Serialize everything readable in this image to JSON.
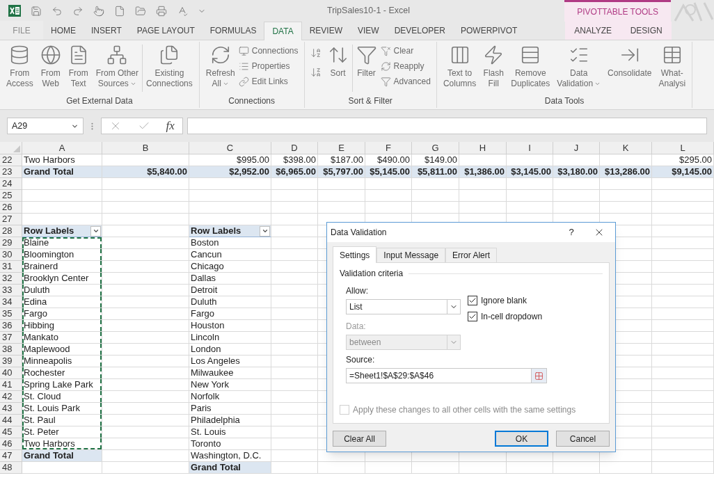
{
  "title_bar": {
    "title": "TripSales10-1 - Excel",
    "context_header": "PIVOTTABLE TOOLS"
  },
  "ribbon_tabs": [
    {
      "label": "FILE",
      "kind": "file",
      "selected": false
    },
    {
      "label": "HOME",
      "kind": "normal",
      "selected": false
    },
    {
      "label": "INSERT",
      "kind": "normal",
      "selected": false
    },
    {
      "label": "PAGE LAYOUT",
      "kind": "normal",
      "selected": false
    },
    {
      "label": "FORMULAS",
      "kind": "normal",
      "selected": false
    },
    {
      "label": "DATA",
      "kind": "normal",
      "selected": true
    },
    {
      "label": "REVIEW",
      "kind": "normal",
      "selected": false
    },
    {
      "label": "VIEW",
      "kind": "normal",
      "selected": false
    },
    {
      "label": "DEVELOPER",
      "kind": "normal",
      "selected": false
    },
    {
      "label": "POWERPIVOT",
      "kind": "normal",
      "selected": false
    },
    {
      "label": "ANALYZE",
      "kind": "contextual",
      "selected": false
    },
    {
      "label": "DESIGN",
      "kind": "contextual",
      "selected": false
    }
  ],
  "ribbon": {
    "groups": [
      {
        "label": "Get External Data",
        "items": [
          {
            "kind": "large",
            "lines": [
              "From",
              "Access"
            ],
            "dropdown": false
          },
          {
            "kind": "large",
            "lines": [
              "From",
              "Web"
            ],
            "dropdown": false
          },
          {
            "kind": "large",
            "lines": [
              "From",
              "Text"
            ],
            "dropdown": false
          },
          {
            "kind": "large",
            "lines": [
              "From Other",
              "Sources"
            ],
            "dropdown": true
          },
          {
            "kind": "separator"
          },
          {
            "kind": "large",
            "lines": [
              "Existing",
              "Connections"
            ],
            "dropdown": false
          }
        ]
      },
      {
        "label": "Connections",
        "items": [
          {
            "kind": "large",
            "lines": [
              "Refresh",
              "All"
            ],
            "dropdown": true
          },
          {
            "kind": "stack",
            "entries": [
              "Connections",
              "Properties",
              "Edit Links"
            ]
          }
        ]
      },
      {
        "label": "Sort & Filter",
        "items": [
          {
            "kind": "sort_buttons"
          },
          {
            "kind": "large",
            "lines": [
              "Sort"
            ],
            "dropdown": false
          },
          {
            "kind": "separator"
          },
          {
            "kind": "large",
            "lines": [
              "Filter"
            ],
            "dropdown": false
          },
          {
            "kind": "stack",
            "entries": [
              "Clear",
              "Reapply",
              "Advanced"
            ]
          }
        ]
      },
      {
        "label": "Data Tools",
        "items": [
          {
            "kind": "large",
            "lines": [
              "Text to",
              "Columns"
            ],
            "dropdown": false
          },
          {
            "kind": "large",
            "lines": [
              "Flash",
              "Fill"
            ],
            "dropdown": false
          },
          {
            "kind": "large",
            "lines": [
              "Remove",
              "Duplicates"
            ],
            "dropdown": false
          },
          {
            "kind": "large",
            "lines": [
              "Data",
              "Validation"
            ],
            "dropdown": true
          },
          {
            "kind": "large",
            "lines": [
              "Consolidate"
            ],
            "dropdown": false
          },
          {
            "kind": "large",
            "lines": [
              "What-",
              "Analysi"
            ],
            "dropdown": false
          }
        ]
      }
    ]
  },
  "formula_bar": {
    "name_box": "A29",
    "function_label": "fx"
  },
  "sheet": {
    "columns": [
      "A",
      "B",
      "C",
      "D",
      "E",
      "F",
      "G",
      "H",
      "I",
      "J",
      "K",
      "L"
    ],
    "row_numbers": [
      "22",
      "23",
      "24",
      "25",
      "26",
      "27",
      "28",
      "29",
      "30",
      "31",
      "32",
      "33",
      "34",
      "35",
      "36",
      "37",
      "38",
      "39",
      "40",
      "41",
      "42",
      "43",
      "44",
      "45",
      "46",
      "47",
      "48"
    ],
    "rows": [
      {
        "kind": "values",
        "cells": [
          "Two Harbors",
          "",
          "$995.00",
          "$398.00",
          "$187.00",
          "$490.00",
          "$149.00",
          "",
          "",
          "",
          "",
          "$295.00"
        ]
      },
      {
        "kind": "grand_total",
        "cells": [
          "Grand Total",
          "$5,840.00",
          "$2,952.00",
          "$6,965.00",
          "$5,797.00",
          "$5,145.00",
          "$5,811.00",
          "$1,386.00",
          "$3,145.00",
          "$3,180.00",
          "$13,286.00",
          "$9,145.00"
        ]
      }
    ],
    "pivots": [
      {
        "header": "Row Labels",
        "copy_marquee": true,
        "items": [
          "Blaine",
          "Bloomington",
          "Brainerd",
          "Brooklyn Center",
          "Duluth",
          "Edina",
          "Fargo",
          "Hibbing",
          "Mankato",
          "Maplewood",
          "Minneapolis",
          "Rochester",
          "Spring Lake Park",
          "St. Cloud",
          "St. Louis Park",
          "St. Paul",
          "St. Peter",
          "Two Harbors"
        ],
        "total": "Grand Total"
      },
      {
        "header": "Row Labels",
        "copy_marquee": false,
        "items": [
          "Boston",
          "Cancun",
          "Chicago",
          "Dallas",
          "Detroit",
          "Duluth",
          "Fargo",
          "Houston",
          "Lincoln",
          "London",
          "Los Angeles",
          "Milwaukee",
          "New York",
          "Norfolk",
          "Paris",
          "Philadelphia",
          "St. Louis",
          "Toronto",
          "Washington, D.C."
        ],
        "total": "Grand Total"
      }
    ]
  },
  "dialog": {
    "title": "Data Validation",
    "help": "?",
    "tabs": [
      {
        "label": "Settings",
        "selected": true
      },
      {
        "label": "Input Message",
        "selected": false
      },
      {
        "label": "Error Alert",
        "selected": false
      }
    ],
    "section": "Validation criteria",
    "allow": {
      "label": "Allow:",
      "value": "List"
    },
    "data": {
      "label": "Data:",
      "value": "between",
      "disabled": true
    },
    "checkboxes": [
      {
        "label": "Ignore blank",
        "checked": true
      },
      {
        "label": "In-cell dropdown",
        "checked": true
      }
    ],
    "source": {
      "label": "Source:",
      "value": "=Sheet1!$A$29:$A$46"
    },
    "apply_all": {
      "label": "Apply these changes to all other cells with the same settings",
      "checked": false,
      "disabled": true
    },
    "buttons": [
      {
        "label": "Clear All",
        "kind": "left",
        "default": false
      },
      {
        "label": "OK",
        "kind": "right",
        "default": true
      },
      {
        "label": "Cancel",
        "kind": "right",
        "default": false
      }
    ]
  }
}
